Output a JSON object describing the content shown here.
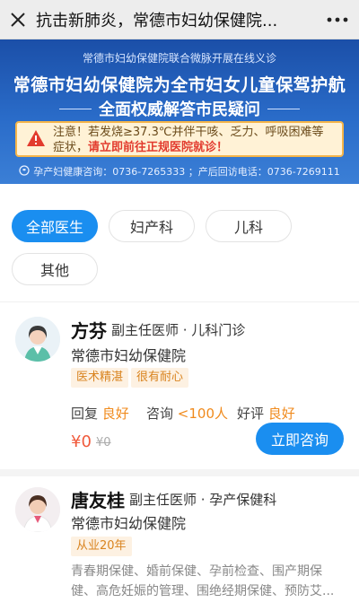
{
  "topbar": {
    "title": "抗击新肺炎，常德市妇幼保健院...",
    "close_icon": "close-icon",
    "more_icon": "more-icon"
  },
  "banner": {
    "top_line": "常德市妇幼保健院联合微脉开展在线义诊",
    "headline": "常德市妇幼保健院为全市妇女儿童保驾护航",
    "subline": "全面权威解答市民疑问",
    "notice_text": "注意！若发烧≥37.3℃并伴干咳、乏力、呼吸困难等症状，",
    "notice_highlight": "请立即前往正规医院就诊！",
    "footer": "孕产妇健康咨询：0736-7265333 ；产后回访电话：0736-7269111",
    "colors": {
      "accent": "#1a8ef0",
      "banner_bg": "#2a6cc9",
      "notice_bg": "#fff2d6"
    }
  },
  "filters": [
    {
      "label": "全部医生",
      "active": true
    },
    {
      "label": "妇产科",
      "active": false
    },
    {
      "label": "儿科",
      "active": false
    },
    {
      "label": "其他",
      "active": false
    }
  ],
  "doctors": [
    {
      "name": "方芬",
      "title": "副主任医师 · 儿科门诊",
      "hospital": "常德市妇幼保健院",
      "tags": [
        "医术精湛",
        "很有耐心"
      ],
      "reply_label": "回复",
      "reply_value": "良好",
      "consult_label": "咨询",
      "consult_value": "<100人",
      "rating_label": "好评",
      "rating_value": "良好",
      "price": "¥0",
      "old_price": "¥0",
      "button": "立即咨询"
    },
    {
      "name": "唐友桂",
      "title": "副主任医师 · 孕产保健科",
      "hospital": "常德市妇幼保健院",
      "tags": [
        "从业20年"
      ],
      "description": "青春期保健、婚前保健、孕前检查、围产期保健、高危妊娠的管理、围绝经期保健、预防艾..."
    }
  ]
}
